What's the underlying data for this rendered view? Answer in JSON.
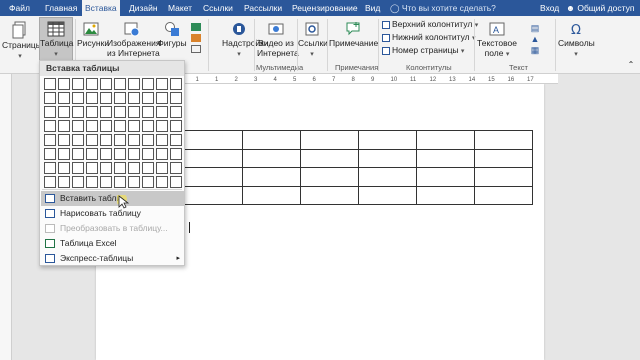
{
  "tabs": {
    "file": "Файл",
    "home": "Главная",
    "insert": "Вставка",
    "design": "Дизайн",
    "layout": "Макет",
    "references": "Ссылки",
    "mailings": "Рассылки",
    "review": "Рецензирование",
    "view": "Вид",
    "tell_me": "Что вы хотите сделать?",
    "sign_in": "Вход",
    "share": "Общий доступ"
  },
  "ribbon": {
    "pages": "Страницы",
    "table": "Таблица",
    "pictures": "Рисунки",
    "online_pictures_1": "Изображения",
    "online_pictures_2": "из Интернета",
    "shapes": "Фигуры",
    "addins": "Надстройки",
    "online_video_1": "Видео из",
    "online_video_2": "Интернета",
    "links": "Ссылки",
    "comment": "Примечание",
    "header": "Верхний колонтитул",
    "footer": "Нижний колонтитул",
    "page_number": "Номер страницы",
    "textbox_1": "Текстовое",
    "textbox_2": "поле",
    "symbols": "Символы",
    "group_media": "Мультимедиа",
    "group_comments": "Примечания",
    "group_header_footer": "Колонтитулы",
    "group_text": "Текст"
  },
  "ruler": {
    "ticks": [
      "2",
      "1",
      "1",
      "2",
      "3",
      "4",
      "5",
      "6",
      "7",
      "8",
      "9",
      "10",
      "11",
      "12",
      "13",
      "14",
      "15",
      "16",
      "17"
    ]
  },
  "dropdown": {
    "title": "Вставка таблицы",
    "grid_cols": 10,
    "grid_rows": 8,
    "items": {
      "insert_table": "Вставить табли",
      "draw_table": "Нарисовать таблицу",
      "convert": "Преобразовать в таблицу...",
      "excel": "Таблица Excel",
      "quick_tables": "Экспресс-таблицы"
    }
  },
  "document": {
    "table_rows": 4,
    "table_cols": 6
  },
  "colors": {
    "accent": "#2b579a",
    "ribbon_bg": "#f3f3f3",
    "hover": "#c8c8c8",
    "pointer_highlight": "#f2e15a"
  }
}
